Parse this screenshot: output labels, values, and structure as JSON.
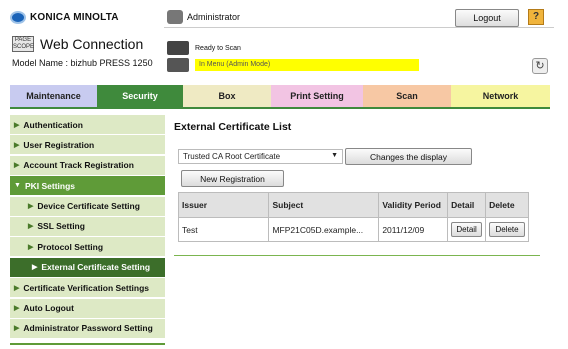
{
  "header": {
    "brand": "KONICA MINOLTA",
    "wc_logo_text": "PAGE SCOPE",
    "product": "Web Connection",
    "model": "Model Name : bizhub PRESS 1250",
    "user": "Administrator",
    "logout_label": "Logout",
    "help_icon": "?",
    "status_ready": "Ready to Scan",
    "status_menu": "In Menu (Admin Mode)",
    "refresh_icon": "↻"
  },
  "tabs": [
    {
      "label": "Maintenance"
    },
    {
      "label": "Security"
    },
    {
      "label": "Box"
    },
    {
      "label": "Print Setting"
    },
    {
      "label": "Scan"
    },
    {
      "label": "Network"
    }
  ],
  "sidebar": {
    "items": [
      {
        "label": "Authentication"
      },
      {
        "label": "User Registration"
      },
      {
        "label": "Account Track Registration"
      },
      {
        "label": "PKI Settings"
      },
      {
        "label": "Device Certificate Setting"
      },
      {
        "label": "SSL Setting"
      },
      {
        "label": "Protocol Setting"
      },
      {
        "label": "External Certificate Setting"
      },
      {
        "label": "Certificate Verification Settings"
      },
      {
        "label": "Auto Logout"
      },
      {
        "label": "Administrator Password Setting"
      }
    ]
  },
  "main": {
    "title": "External Certificate List",
    "select_value": "Trusted CA Root Certificate",
    "change_display_label": "Changes the display",
    "new_registration_label": "New Registration",
    "table": {
      "headers": [
        "Issuer",
        "Subject",
        "Validity Period",
        "Detail",
        "Delete"
      ],
      "rows": [
        {
          "issuer": "Test",
          "subject": "MFP21C05D.example...",
          "validity": "2011/12/09",
          "detail": "Detail",
          "delete": "Delete"
        }
      ]
    }
  },
  "colors": {
    "security_tab": "#3f8a3c",
    "sidebar_active": "#3c6e2a",
    "status_highlight": "#ffff00"
  }
}
